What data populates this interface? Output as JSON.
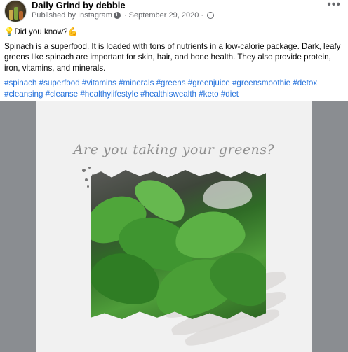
{
  "header": {
    "author_name": "Daily Grind by debbie",
    "published_by": "Published by Instagram",
    "date": "September 29, 2020",
    "icons": [
      "info-icon",
      "globe-icon",
      "more-icon"
    ]
  },
  "post": {
    "lead": "Did you know?",
    "body": "Spinach is a superfood. It is loaded with tons of nutrients in a low-calorie package. Dark, leafy greens like spinach are important for skin, hair, and bone health. They also provide protein, iron, vitamins, and minerals.",
    "hashtags": [
      "#spinach",
      "#superfood",
      "#vitamins",
      "#minerals",
      "#greens",
      "#greenjuice",
      "#greensmoothie",
      "#detox",
      "#cleansing",
      "#cleanse",
      "#healthylifestyle",
      "#healthiswealth",
      "#keto",
      "#diet"
    ]
  },
  "image": {
    "headline": "Are you taking your greens?"
  },
  "colors": {
    "link": "#216fdb",
    "secondary_text": "#65676b",
    "image_backdrop": "#8a8d91",
    "card": "#f1f1f1"
  }
}
